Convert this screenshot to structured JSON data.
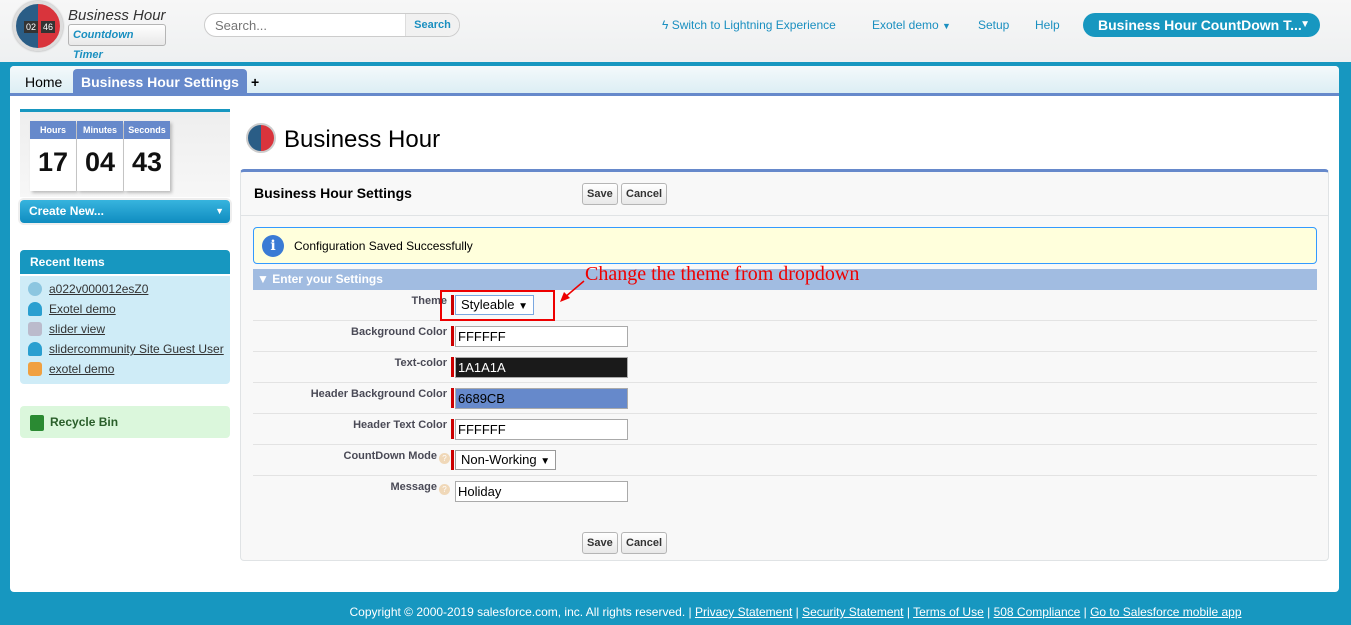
{
  "header": {
    "logo_text": [
      "02",
      "46"
    ],
    "brand_line1": "Business Hour",
    "brand_line2": "Countdown Timer",
    "search_placeholder": "Search...",
    "search_button": "Search",
    "lightning_link": "Switch to Lightning Experience",
    "user_menu": "Exotel demo",
    "setup": "Setup",
    "help": "Help",
    "app_menu": "Business Hour CountDown T..."
  },
  "tabs": [
    {
      "label": "Home"
    },
    {
      "label": "Business Hour Settings",
      "active": true
    },
    {
      "label": "+"
    }
  ],
  "sidebar": {
    "timer": {
      "labels": [
        "Hours",
        "Minutes",
        "Seconds"
      ],
      "values": [
        "17",
        "04",
        "43"
      ]
    },
    "create_new": "Create New...",
    "recent_title": "Recent Items",
    "recent_items": [
      {
        "label": "a022v000012esZ0",
        "icon": "custom-object-icon"
      },
      {
        "label": "Exotel demo",
        "icon": "user-icon"
      },
      {
        "label": "slider view",
        "icon": "page-icon"
      },
      {
        "label": "slidercommunity Site Guest User",
        "icon": "user-icon"
      },
      {
        "label": "exotel demo",
        "icon": "folder-icon"
      }
    ],
    "recycle_bin": "Recycle Bin"
  },
  "page": {
    "title": "Business Hour",
    "block_title": "Business Hour Settings",
    "save": "Save",
    "cancel": "Cancel",
    "message": "Configuration Saved Successfully",
    "section": "Enter your Settings",
    "fields": [
      {
        "label": "Theme",
        "value": "Styleable",
        "type": "select"
      },
      {
        "label": "Background Color",
        "value": "FFFFFF",
        "bg": "#FFFFFF",
        "fg": "#000000"
      },
      {
        "label": "Text-color",
        "value": "1A1A1A",
        "bg": "#1A1A1A",
        "fg": "#FFFFFF"
      },
      {
        "label": "Header Background Color",
        "value": "6689CB",
        "bg": "#6689CB",
        "fg": "#000000"
      },
      {
        "label": "Header Text Color",
        "value": "FFFFFF",
        "bg": "#FFFFFF",
        "fg": "#000000"
      },
      {
        "label": "CountDown Mode",
        "value": "Non-Working",
        "type": "select",
        "help": true
      },
      {
        "label": "Message",
        "value": "Holiday",
        "help": true
      }
    ],
    "annotation": "Change the theme from dropdown"
  },
  "footer": {
    "copyright": "Copyright © 2000-2019 salesforce.com, inc. All rights reserved. |",
    "links": [
      "Privacy Statement",
      "Security Statement",
      "Terms of Use",
      "508 Compliance",
      "Go to Salesforce mobile app"
    ]
  },
  "colors": {
    "accent": "#1797C0",
    "tab_active": "#6689CB",
    "required": "#CC0000",
    "annotation": "#EE0000"
  }
}
